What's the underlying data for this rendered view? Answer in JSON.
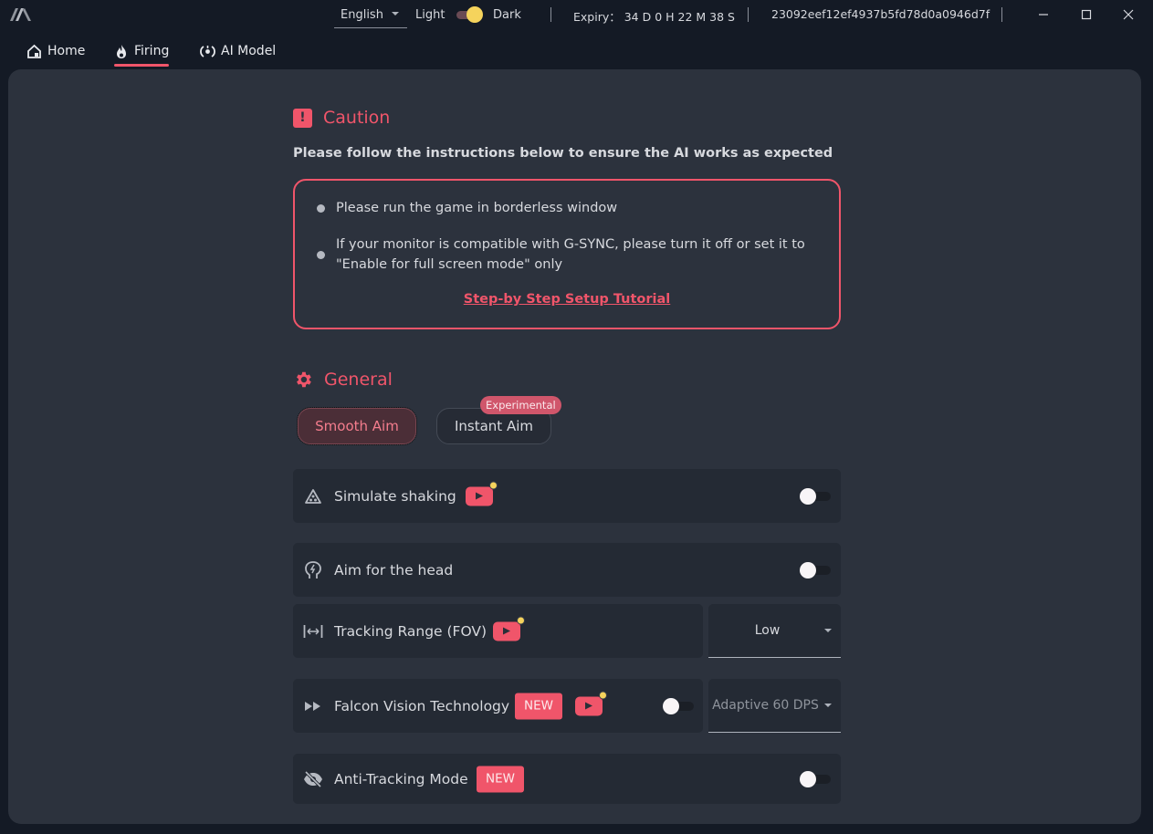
{
  "titlebar": {
    "language": "English",
    "theme_light_label": "Light",
    "theme_dark_label": "Dark",
    "theme_mode": "dark",
    "expiry": "Expiry：  34 D 0 H 22 M 38 S",
    "license_key": "23092eef12ef4937b5fd78d0a0946d7f",
    "window_controls": [
      "minimize-icon",
      "maximize-icon",
      "close-icon"
    ]
  },
  "nav": {
    "items": [
      {
        "label": "Home",
        "icon": "home-icon",
        "active": false
      },
      {
        "label": "Firing",
        "icon": "fire-icon",
        "active": true
      },
      {
        "label": "AI Model",
        "icon": "ai-model-icon",
        "active": false
      }
    ]
  },
  "caution": {
    "title": "Caution",
    "subtitle": "Please follow the instructions below to ensure the AI works as expected",
    "bullets": [
      "Please run the game in borderless window",
      "If your monitor is compatible with G-SYNC, please turn it off or set it to \"Enable for full screen mode\" only"
    ],
    "tutorial_link": "Step-by Step Setup Tutorial"
  },
  "general": {
    "title": "General",
    "modes": [
      {
        "label": "Smooth Aim",
        "selected": true
      },
      {
        "label": "Instant Aim",
        "selected": false,
        "badge": "Experimental"
      }
    ],
    "settings": [
      {
        "label": "Simulate shaking",
        "icon": "shaking-icon",
        "video": true,
        "enabled": false
      },
      {
        "label": "Aim for the head",
        "icon": "head-icon",
        "enabled": false
      },
      {
        "label": "Tracking Range (FOV)",
        "icon": "range-icon",
        "video": true,
        "select_value": "Low"
      },
      {
        "label": "Falcon Vision Technology",
        "icon": "fast-forward-icon",
        "badge": "NEW",
        "video": true,
        "enabled": false,
        "select_value": "Adaptive 60 DPS"
      },
      {
        "label": "Anti-Tracking Mode",
        "icon": "eye-off-icon",
        "badge": "NEW",
        "enabled": false
      }
    ]
  },
  "colors": {
    "accent": "#f0556a",
    "background": "#141a25",
    "panel": "#2c323d",
    "row": "#242a34",
    "highlight_yellow": "#f5d35c"
  }
}
